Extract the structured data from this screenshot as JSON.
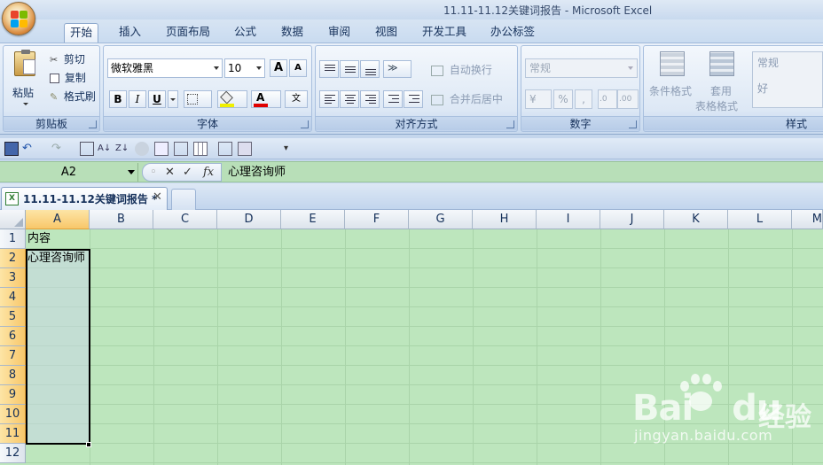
{
  "window": {
    "title": "11.11-11.12关键词报告 - Microsoft Excel"
  },
  "tabs": [
    {
      "label": "开始",
      "active": true
    },
    {
      "label": "插入"
    },
    {
      "label": "页面布局"
    },
    {
      "label": "公式"
    },
    {
      "label": "数据"
    },
    {
      "label": "审阅"
    },
    {
      "label": "视图"
    },
    {
      "label": "开发工具"
    },
    {
      "label": "办公标签"
    }
  ],
  "ribbon": {
    "clipboard": {
      "label": "剪贴板",
      "paste": "粘贴",
      "cut": "剪切",
      "copy": "复制",
      "format_painter": "格式刷"
    },
    "font": {
      "label": "字体",
      "font_name": "微软雅黑",
      "font_size": "10",
      "bold": "B",
      "italic": "I",
      "underline": "U",
      "grow": "A",
      "shrink": "A",
      "font_color": "A"
    },
    "alignment": {
      "label": "对齐方式",
      "wrap_text": "自动换行",
      "merge_center": "合并后居中"
    },
    "number": {
      "label": "数字",
      "format": "常规",
      "percent": "%",
      "comma": ",",
      "inc_decimal": ".0",
      "dec_decimal": ".00"
    },
    "styles": {
      "label": "样式",
      "conditional": "条件格式",
      "table_format_1": "套用",
      "table_format_2": "表格格式",
      "style_normal": "常规",
      "style_good": "好"
    }
  },
  "formula_bar": {
    "name_box": "A2",
    "cancel": "✕",
    "enter": "✓",
    "fx": "fx",
    "content": "心理咨询师"
  },
  "workbook_tab": {
    "title": "11.11-11.12关键词报告 *",
    "close": "✕"
  },
  "grid": {
    "columns": [
      "A",
      "B",
      "C",
      "D",
      "E",
      "F",
      "G",
      "H",
      "I",
      "J",
      "K",
      "L",
      "M"
    ],
    "rows": [
      "1",
      "2",
      "3",
      "4",
      "5",
      "6",
      "7",
      "8",
      "9",
      "10",
      "11",
      "12"
    ],
    "cells": {
      "A1": "内容",
      "A2": "心理咨询师"
    },
    "selected_range": "A2:A11"
  },
  "watermark": {
    "brand": "Bai",
    "brand2": "du",
    "jingyan": "经验",
    "url": "jingyan.baidu.com"
  }
}
